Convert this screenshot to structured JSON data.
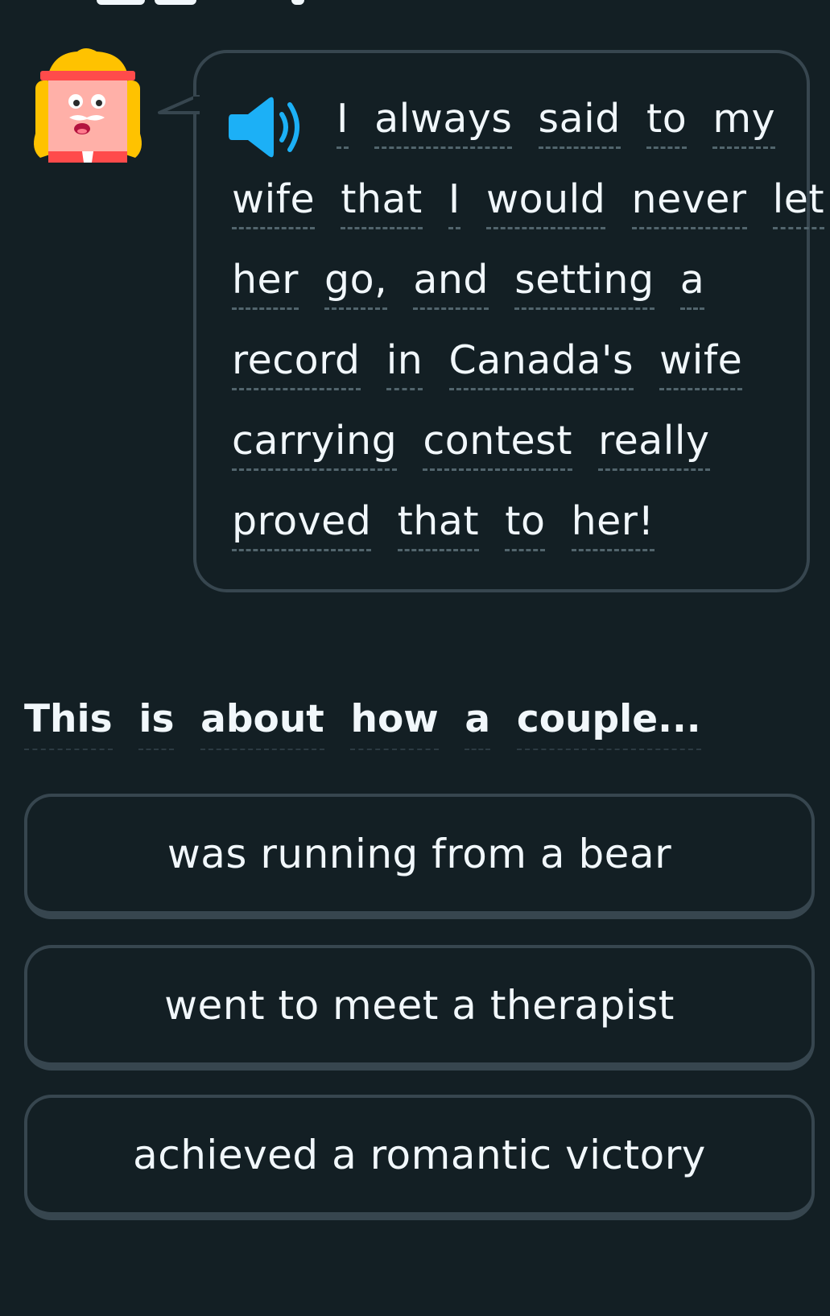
{
  "dialog": {
    "lines": [
      [
        "I",
        "always",
        "said",
        "to",
        "my"
      ],
      [
        "wife",
        "that",
        "I",
        "would",
        "never",
        "let"
      ],
      [
        "her",
        "go,",
        "and",
        "setting",
        "a"
      ],
      [
        "record",
        "in",
        "Canada's",
        "wife"
      ],
      [
        "carrying",
        "contest",
        "really"
      ],
      [
        "proved",
        "that",
        "to",
        "her!"
      ]
    ]
  },
  "prompt": {
    "words": [
      "This",
      "is",
      "about",
      "how",
      "a",
      "couple..."
    ]
  },
  "options": [
    {
      "label": "was running from a bear"
    },
    {
      "label": "went to meet a therapist"
    },
    {
      "label": "achieved a romantic victory"
    }
  ],
  "colors": {
    "background": "#131f24",
    "border": "#37464f",
    "text": "#f1f7fb",
    "speaker": "#1cb0f6",
    "dash": "#52656d"
  },
  "icons": {
    "speaker": "speaker-icon",
    "character": "character-avatar"
  }
}
